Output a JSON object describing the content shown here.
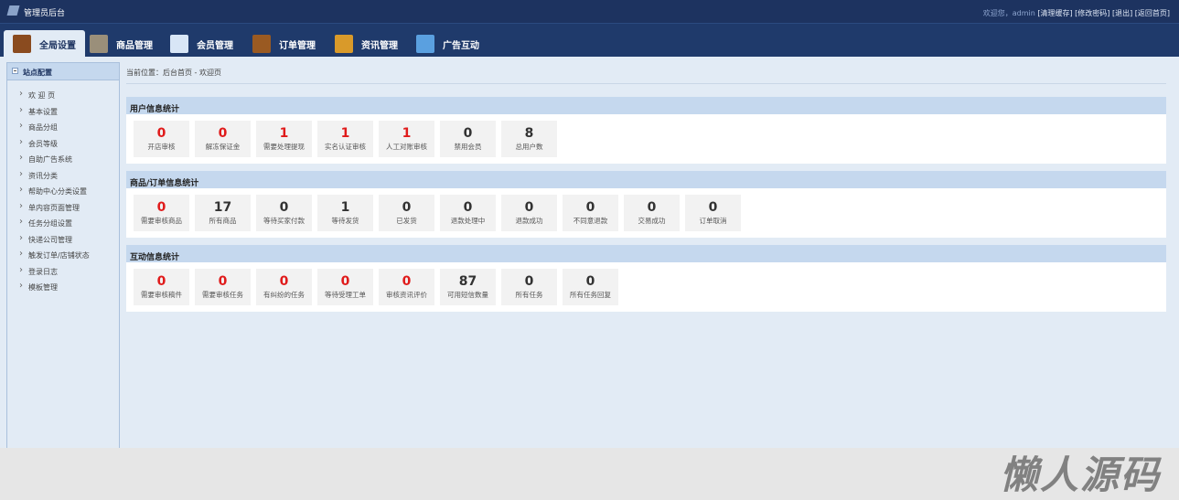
{
  "header": {
    "title": "管理员后台",
    "welcome": "欢迎您，admin",
    "links": [
      "[清理缓存]",
      "[修改密码]",
      "[退出]",
      "[返回首页]"
    ]
  },
  "nav": [
    {
      "label": "全局设置",
      "color": "#8a4b1f"
    },
    {
      "label": "商品管理",
      "color": "#9a8f7a"
    },
    {
      "label": "会员管理",
      "color": "#d8e6f6"
    },
    {
      "label": "订单管理",
      "color": "#9a5a22"
    },
    {
      "label": "资讯管理",
      "color": "#d99a2a"
    },
    {
      "label": "广告互动",
      "color": "#5aa0e0"
    }
  ],
  "sidebar": {
    "title": "站点配置",
    "items": [
      "欢 迎 页",
      "基本设置",
      "商品分组",
      "会员等级",
      "自助广告系统",
      "资讯分类",
      "帮助中心分类设置",
      "单内容页面管理",
      "任务分组设置",
      "快递公司管理",
      "触发订单/店铺状态",
      "登录日志",
      "模板管理"
    ]
  },
  "breadcrumb": "当前位置：后台首页 - 欢迎页",
  "panels": [
    {
      "title": "用户信息统计",
      "cards": [
        {
          "n": "0",
          "t": "开店审核",
          "nc": "red",
          "tc": "dark"
        },
        {
          "n": "0",
          "t": "解冻保证金",
          "nc": "red",
          "tc": "dark"
        },
        {
          "n": "1",
          "t": "需要处理提现",
          "nc": "red",
          "tc": "dark"
        },
        {
          "n": "1",
          "t": "实名认证审核",
          "nc": "red",
          "tc": "dark"
        },
        {
          "n": "1",
          "t": "人工对账审核",
          "nc": "red",
          "tc": "dark"
        },
        {
          "n": "0",
          "t": "禁用会员",
          "nc": "dark",
          "tc": "dark"
        },
        {
          "n": "8",
          "t": "总用户数",
          "nc": "dark",
          "tc": "dark"
        }
      ]
    },
    {
      "title": "商品/订单信息统计",
      "cards": [
        {
          "n": "0",
          "t": "需要审核商品",
          "nc": "red",
          "tc": "dark"
        },
        {
          "n": "17",
          "t": "所有商品",
          "nc": "dark",
          "tc": "dark"
        },
        {
          "n": "0",
          "t": "等待买家付款",
          "nc": "dark",
          "tc": "gray"
        },
        {
          "n": "1",
          "t": "等待发货",
          "nc": "dark",
          "tc": "red"
        },
        {
          "n": "0",
          "t": "已发货",
          "nc": "dark",
          "tc": "blue"
        },
        {
          "n": "0",
          "t": "退款处理中",
          "nc": "dark",
          "tc": "orange"
        },
        {
          "n": "0",
          "t": "退款成功",
          "nc": "dark",
          "tc": "gray"
        },
        {
          "n": "0",
          "t": "不同意退款",
          "nc": "dark",
          "tc": "red"
        },
        {
          "n": "0",
          "t": "交易成功",
          "nc": "dark",
          "tc": "green"
        },
        {
          "n": "0",
          "t": "订单取消",
          "nc": "dark",
          "tc": "gray"
        }
      ]
    },
    {
      "title": "互动信息统计",
      "cards": [
        {
          "n": "0",
          "t": "需要审核稿件",
          "nc": "red",
          "tc": "dark"
        },
        {
          "n": "0",
          "t": "需要审核任务",
          "nc": "red",
          "tc": "dark"
        },
        {
          "n": "0",
          "t": "有纠纷的任务",
          "nc": "red",
          "tc": "dark"
        },
        {
          "n": "0",
          "t": "等待受理工单",
          "nc": "red",
          "tc": "dark"
        },
        {
          "n": "0",
          "t": "审核资讯评价",
          "nc": "red",
          "tc": "dark"
        },
        {
          "n": "87",
          "t": "可用短信数量",
          "nc": "dark",
          "tc": "dark"
        },
        {
          "n": "0",
          "t": "所有任务",
          "nc": "dark",
          "tc": "dark"
        },
        {
          "n": "0",
          "t": "所有任务回复",
          "nc": "dark",
          "tc": "dark"
        }
      ]
    }
  ],
  "watermark": "懒人源码"
}
